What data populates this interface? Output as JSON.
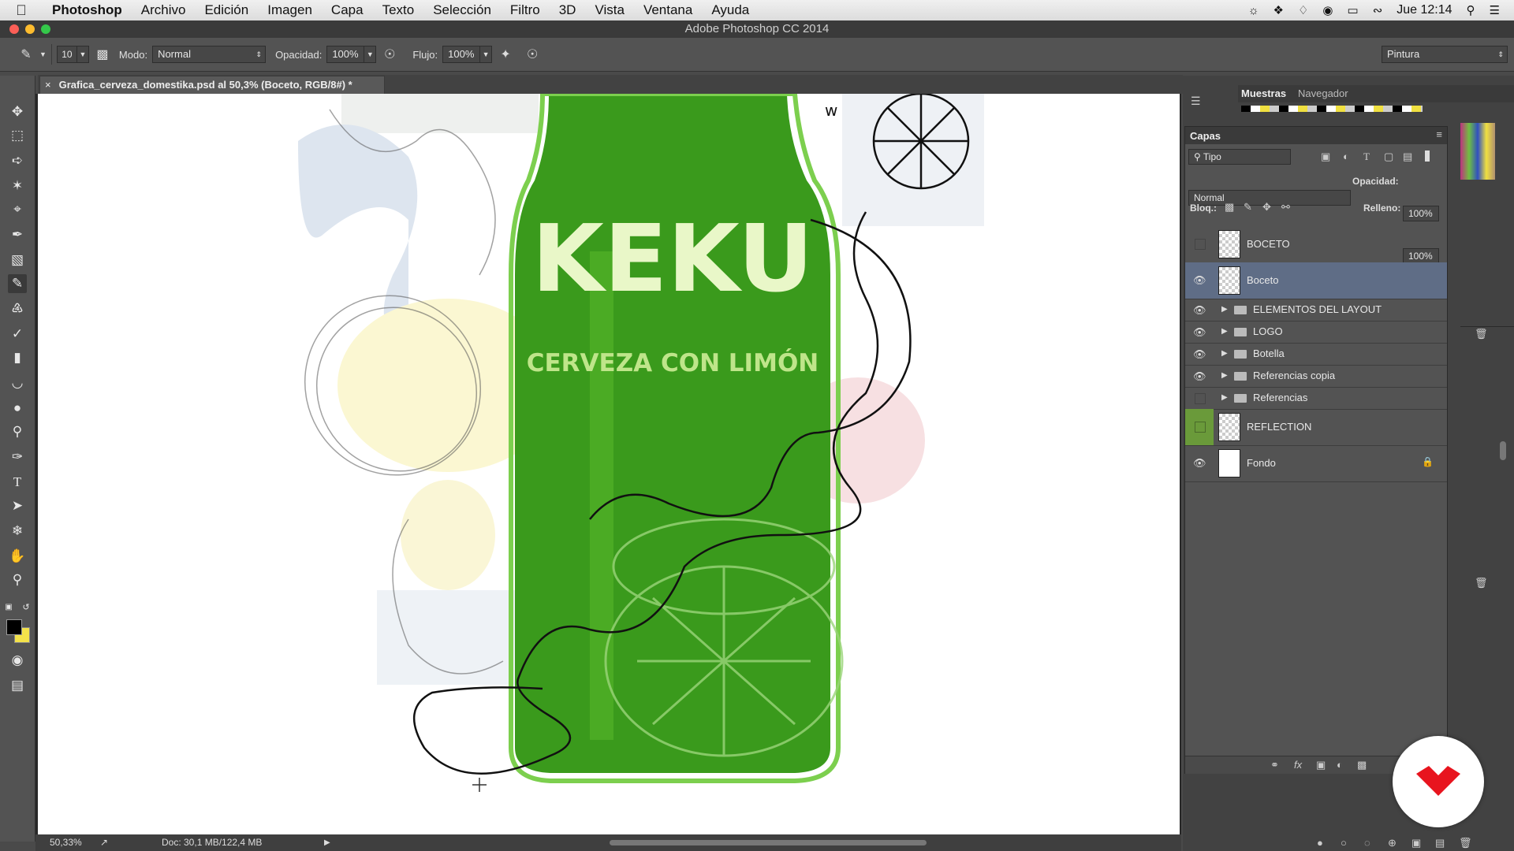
{
  "menubar": {
    "app_name": "Photoshop",
    "items": [
      "Archivo",
      "Edición",
      "Imagen",
      "Capa",
      "Texto",
      "Selección",
      "Filtro",
      "3D",
      "Vista",
      "Ventana",
      "Ayuda"
    ],
    "clock": "Jue 12:14"
  },
  "window": {
    "title": "Adobe Photoshop CC 2014"
  },
  "options": {
    "brush_size": "10",
    "mode_label": "Modo:",
    "mode_value": "Normal",
    "opacity_label": "Opacidad:",
    "opacity_value": "100%",
    "flow_label": "Flujo:",
    "flow_value": "100%",
    "workspace": "Pintura"
  },
  "document": {
    "tab_title": "Grafica_cerveza_domestika.psd al 50,3% (Boceto, RGB/8#) *",
    "brand": "KEKU",
    "tagline": "CERVEZA CON LIMÓN"
  },
  "status": {
    "zoom": "50,33%",
    "doc_size": "Doc: 30,1 MB/122,4 MB"
  },
  "panels": {
    "swatches_tab": "Muestras",
    "navigator_tab": "Navegador",
    "layers_tab": "Capas",
    "filter_kind": "Tipo",
    "blend_mode": "Normal",
    "opacity_label": "Opacidad:",
    "opacity_value": "100%",
    "lock_label": "Bloq.:",
    "fill_label": "Relleno:",
    "fill_value": "100%"
  },
  "layers": [
    {
      "name": "BOCETO",
      "visible": false,
      "type": "layer",
      "selected": false
    },
    {
      "name": "Boceto",
      "visible": true,
      "type": "layer",
      "selected": true
    },
    {
      "name": "ELEMENTOS DEL LAYOUT",
      "visible": true,
      "type": "group",
      "selected": false
    },
    {
      "name": "LOGO",
      "visible": true,
      "type": "group",
      "selected": false
    },
    {
      "name": "Botella",
      "visible": true,
      "type": "group",
      "selected": false
    },
    {
      "name": "Referencias copia",
      "visible": true,
      "type": "group",
      "selected": false
    },
    {
      "name": "Referencias",
      "visible": false,
      "type": "group",
      "selected": false
    },
    {
      "name": "REFLECTION",
      "visible": false,
      "type": "layer",
      "selected": false,
      "color_tag": "#6a9a3a"
    },
    {
      "name": "Fondo",
      "visible": true,
      "type": "background",
      "selected": false,
      "locked": true
    }
  ],
  "colors": {
    "foreground": "#000000",
    "background": "#f3e24a",
    "bottle": "#3a9a1c",
    "accent_logo": "#e8141e"
  }
}
